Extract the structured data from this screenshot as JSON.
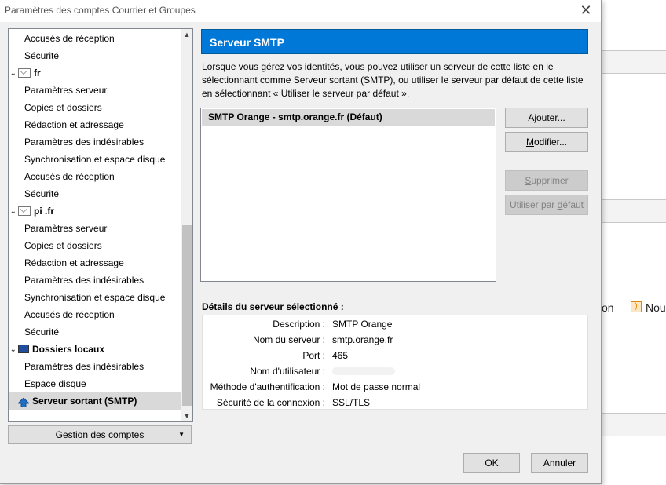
{
  "background": {
    "text_partial": "on",
    "text_partial2": "Nou"
  },
  "window": {
    "title": "Paramètres des comptes Courrier et Groupes",
    "close_glyph": "✕"
  },
  "tree": {
    "items": [
      {
        "label": "Accusés de réception",
        "kind": "child"
      },
      {
        "label": "Sécurité",
        "kind": "child"
      },
      {
        "label": "fr",
        "kind": "account"
      },
      {
        "label": "Paramètres serveur",
        "kind": "child"
      },
      {
        "label": "Copies et dossiers",
        "kind": "child"
      },
      {
        "label": "Rédaction et adressage",
        "kind": "child"
      },
      {
        "label": "Paramètres des indésirables",
        "kind": "child"
      },
      {
        "label": "Synchronisation et espace disque",
        "kind": "child"
      },
      {
        "label": "Accusés de réception",
        "kind": "child"
      },
      {
        "label": "Sécurité",
        "kind": "child"
      },
      {
        "label": "pi       .fr",
        "kind": "account"
      },
      {
        "label": "Paramètres serveur",
        "kind": "child"
      },
      {
        "label": "Copies et dossiers",
        "kind": "child"
      },
      {
        "label": "Rédaction et adressage",
        "kind": "child"
      },
      {
        "label": "Paramètres des indésirables",
        "kind": "child"
      },
      {
        "label": "Synchronisation et espace disque",
        "kind": "child"
      },
      {
        "label": "Accusés de réception",
        "kind": "child"
      },
      {
        "label": "Sécurité",
        "kind": "child"
      },
      {
        "label": "Dossiers locaux",
        "kind": "local"
      },
      {
        "label": "Paramètres des indésirables",
        "kind": "child"
      },
      {
        "label": "Espace disque",
        "kind": "child"
      },
      {
        "label": "Serveur sortant (SMTP)",
        "kind": "smtp",
        "selected": true
      }
    ]
  },
  "manage_button": {
    "label_underlined": "G",
    "label_rest": "estion des comptes",
    "arrow": "▼"
  },
  "panel": {
    "header": "Serveur SMTP",
    "description": "Lorsque vous gérez vos identités, vous pouvez utiliser un serveur de cette liste en le sélectionnant comme Serveur sortant (SMTP), ou utiliser le serveur par défaut de cette liste en sélectionnant « Utiliser le serveur par défaut ».",
    "servers": [
      "SMTP Orange - smtp.orange.fr (Défaut)"
    ],
    "buttons": {
      "add": {
        "u": "A",
        "rest": "jouter..."
      },
      "modify": {
        "u": "M",
        "rest": "odifier..."
      },
      "delete": {
        "u": "S",
        "rest": "upprimer"
      },
      "set_default_pre": "Utiliser par ",
      "set_default_u": "d",
      "set_default_rest": "éfaut"
    },
    "details_label": "Détails du serveur sélectionné :",
    "details": [
      {
        "label": "Description :",
        "value": "SMTP Orange"
      },
      {
        "label": "Nom du serveur :",
        "value": "smtp.orange.fr"
      },
      {
        "label": "Port :",
        "value": "465"
      },
      {
        "label": "Nom d'utilisateur :",
        "value": ""
      },
      {
        "label": "Méthode d'authentification :",
        "value": "Mot de passe normal"
      },
      {
        "label": "Sécurité de la connexion :",
        "value": "SSL/TLS"
      }
    ]
  },
  "footer": {
    "ok": "OK",
    "cancel": "Annuler"
  },
  "colors": {
    "accent": "#0078d7",
    "selection": "#d9d9d9"
  }
}
